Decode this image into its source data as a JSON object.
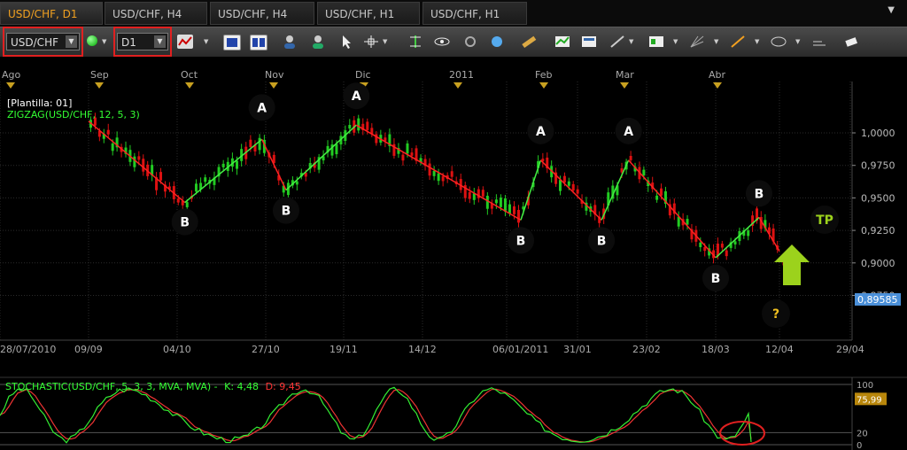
{
  "tabs": [
    {
      "label": "USD/CHF, D1",
      "active": true
    },
    {
      "label": "USD/CHF, H4",
      "active": false
    },
    {
      "label": "USD/CHF, H4",
      "active": false
    },
    {
      "label": "USD/CHF, H1",
      "active": false
    },
    {
      "label": "USD/CHF, H1",
      "active": false
    }
  ],
  "tabs_menu_icon": "chevron-down-icon",
  "toolbar": {
    "symbol_value": "USD/CHF",
    "timeframe_value": "D1",
    "tools": [
      "connection-icon",
      "chart-type-icon",
      "cascade-icon",
      "tile-icon",
      "trader-icon",
      "user-icon",
      "cursor-icon",
      "crosshair-icon",
      "period-separator-icon",
      "eye-icon",
      "refresh-icon",
      "zoom-icon",
      "ruler-icon",
      "indicators-icon",
      "templates-icon",
      "line-tools-icon",
      "objects-icon",
      "fan-icon",
      "pen-icon",
      "ellipse-icon",
      "text-icon",
      "eraser-icon"
    ],
    "accent": "#e02020"
  },
  "main_chart": {
    "template_label": "[Plantilla: 01]",
    "indicator_label": "ZIGZAG(USD/CHF, 12, 5, 3)",
    "month_labels": [
      "Ago",
      "Sep",
      "Oct",
      "Nov",
      "Dic",
      "2011",
      "Feb",
      "Mar",
      "Abr"
    ],
    "date_labels": [
      "28/07/2010",
      "09/09",
      "04/10",
      "27/10",
      "19/11",
      "14/12",
      "06/01/2011",
      "31/01",
      "23/02",
      "18/03",
      "12/04",
      "29/04"
    ],
    "price_labels": [
      "1,0000",
      "0,9750",
      "0,9500",
      "0,9250",
      "0,9000",
      "0,8750"
    ],
    "current_price": "0,89585",
    "wave_labels": [
      "B",
      "A",
      "B",
      "A",
      "B",
      "A",
      "B",
      "A",
      "B",
      "B"
    ],
    "question_label": "?",
    "tp_label": "TP",
    "colors": {
      "bull": "#22cc22",
      "bear": "#dd1111",
      "zigzag_up": "#44ee44",
      "zigzag_down": "#ff2222",
      "grid": "#2a2a2a",
      "arrow": "#9cd21c",
      "price_box": "#4a8fd8"
    }
  },
  "stochastic": {
    "label": "STOCHASTIC(USD/CHF, 5, 3, 3, MVA, MVA) -",
    "k_label": "K: 4,48",
    "d_label": "D: 9,45",
    "levels": [
      "100",
      "75,99",
      "20",
      "0"
    ]
  },
  "chart_data": {
    "type": "line",
    "title": "USD/CHF, D1",
    "x": [
      "28/07/2010",
      "09/09",
      "04/10",
      "27/10",
      "19/11",
      "14/12",
      "06/01/2011",
      "31/01",
      "23/02",
      "18/03",
      "12/04",
      "29/04"
    ],
    "ylim": [
      0.875,
      1.0
    ],
    "series": [
      {
        "name": "ZIGZAG(USD/CHF, 12, 5, 3)",
        "points": [
          {
            "x": "09/09",
            "y": 1.009
          },
          {
            "x": "06/10",
            "y": 0.9465
          },
          {
            "x": "26/10",
            "y": 0.995
          },
          {
            "x": "02/11",
            "y": 0.956
          },
          {
            "x": "23/11",
            "y": 1.006
          },
          {
            "x": "11/01",
            "y": 0.933
          },
          {
            "x": "18/01",
            "y": 0.979
          },
          {
            "x": "08/02",
            "y": 0.933
          },
          {
            "x": "17/02",
            "y": 0.979
          },
          {
            "x": "18/03",
            "y": 0.904
          },
          {
            "x": "04/04",
            "y": 0.935
          },
          {
            "x": "12/04",
            "y": 0.909
          }
        ]
      }
    ],
    "current_price": 0.89585,
    "stochastic": {
      "k": 4.48,
      "d": 9.45,
      "levels": [
        100,
        75.99,
        20,
        0
      ]
    }
  }
}
